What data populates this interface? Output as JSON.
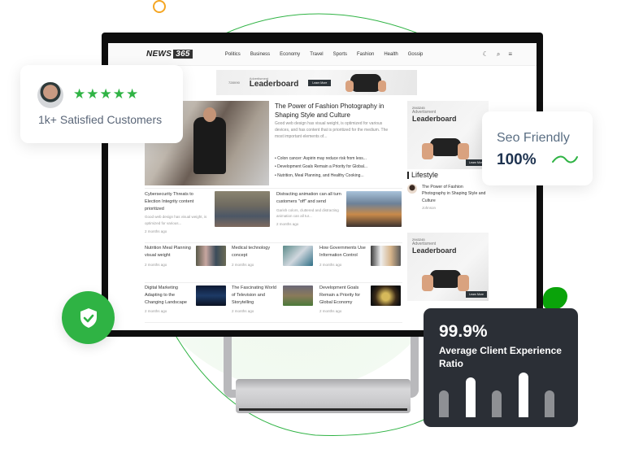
{
  "site": {
    "logo_word": "NEWS",
    "logo_num": "365",
    "nav": [
      "Politics",
      "Business",
      "Economy",
      "Travel",
      "Sports",
      "Fashion",
      "Health",
      "Gossip"
    ],
    "icons": [
      "moon-icon",
      "search-icon",
      "menu-icon"
    ]
  },
  "ad_top": {
    "size": "728X90",
    "label": "Advertisment",
    "title": "Leaderboard",
    "cta": "Learn More"
  },
  "hero": {
    "title": "The Power of Fashion Photography in Shaping Style and Culture",
    "desc": "Good web design has visual weight, is optimized for various devices, and has content that is prioritized for the medium. The most important elements of...",
    "bullets": [
      "Colon cancer: Aspirin may reduce risk from less...",
      "Development Goals Remain a Priority for Global...",
      "Nutrition, Meal Planning, and Healthy Cooking..."
    ]
  },
  "side": {
    "ad": {
      "size": "2943245",
      "label": "Advertisment",
      "title": "Leaderboard",
      "cta": "Learn More"
    },
    "section": "Lifestyle",
    "item": {
      "title": "The Power of Fashion Photography in Shaping Style and Culture",
      "author": "Johnson"
    },
    "ad2": {
      "size": "2943245",
      "label": "Advertisment",
      "title": "Leaderboard",
      "cta": "Learn More"
    }
  },
  "row2": [
    {
      "title": "Cybersecurity Threats to Election Integrity content prioritized",
      "desc": "Good web design has visual weight, is optimized for various...",
      "time": "2 months ago"
    },
    {
      "title": "Distracting animation can all turn customers \"off\" and send",
      "desc": "Garish colors, cluttered and distracting animation can all tur...",
      "time": "2 months ago"
    }
  ],
  "grid": [
    {
      "title": "Nutrition Meal Planning visual weight",
      "time": "2 months ago"
    },
    {
      "title": "Medical technology concept",
      "time": "2 months ago"
    },
    {
      "title": "How Governments Use Information Control",
      "time": "2 months ago"
    },
    {
      "title": "Digital Marketing Adapting to the Changing Landscape",
      "time": "2 months ago"
    },
    {
      "title": "The Fascinating World of Television and Storytelling",
      "time": "2 months ago"
    },
    {
      "title": "Development Goals Remain a Priority for Global Economy",
      "time": "2 months ago"
    }
  ],
  "customers": {
    "rating": 5,
    "stars": "★★★★★",
    "text": "1k+ Satisfied Customers"
  },
  "seo": {
    "title": "Seo Friendly",
    "value": "100%"
  },
  "experience": {
    "value": "99.9%",
    "label": "Average Client Experience Ratio",
    "bars": [
      0.6,
      0.9,
      0.6,
      1.0,
      0.6
    ],
    "bar_highlight": [
      false,
      true,
      false,
      true,
      false
    ]
  },
  "colors": {
    "accent": "#2fb344",
    "dark_card": "#2b2f36",
    "orange": "#f5a623",
    "seo_value": "#1e3350"
  }
}
